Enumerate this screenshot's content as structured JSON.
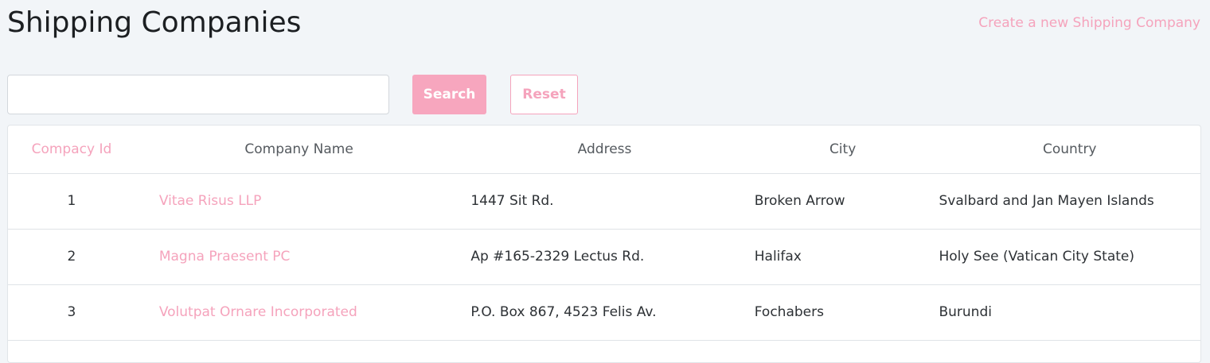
{
  "page": {
    "title": "Shipping Companies",
    "create_link": "Create a new Shipping Company"
  },
  "search": {
    "value": "",
    "placeholder": "",
    "search_label": "Search",
    "reset_label": "Reset"
  },
  "table": {
    "headers": {
      "id": "Compacy Id",
      "name": "Company Name",
      "address": "Address",
      "city": "City",
      "country": "Country"
    },
    "rows": [
      {
        "id": "1",
        "name": "Vitae Risus LLP",
        "address": "1447 Sit Rd.",
        "city": "Broken Arrow",
        "country": "Svalbard and Jan Mayen Islands"
      },
      {
        "id": "2",
        "name": "Magna Praesent PC",
        "address": "Ap #165-2329 Lectus Rd.",
        "city": "Halifax",
        "country": "Holy See (Vatican City State)"
      },
      {
        "id": "3",
        "name": "Volutpat Ornare Incorporated",
        "address": "P.O. Box 867, 4523 Felis Av.",
        "city": "Fochabers",
        "country": "Burundi"
      }
    ]
  },
  "colors": {
    "accent": "#f5a3bc",
    "background": "#f2f5f8"
  }
}
